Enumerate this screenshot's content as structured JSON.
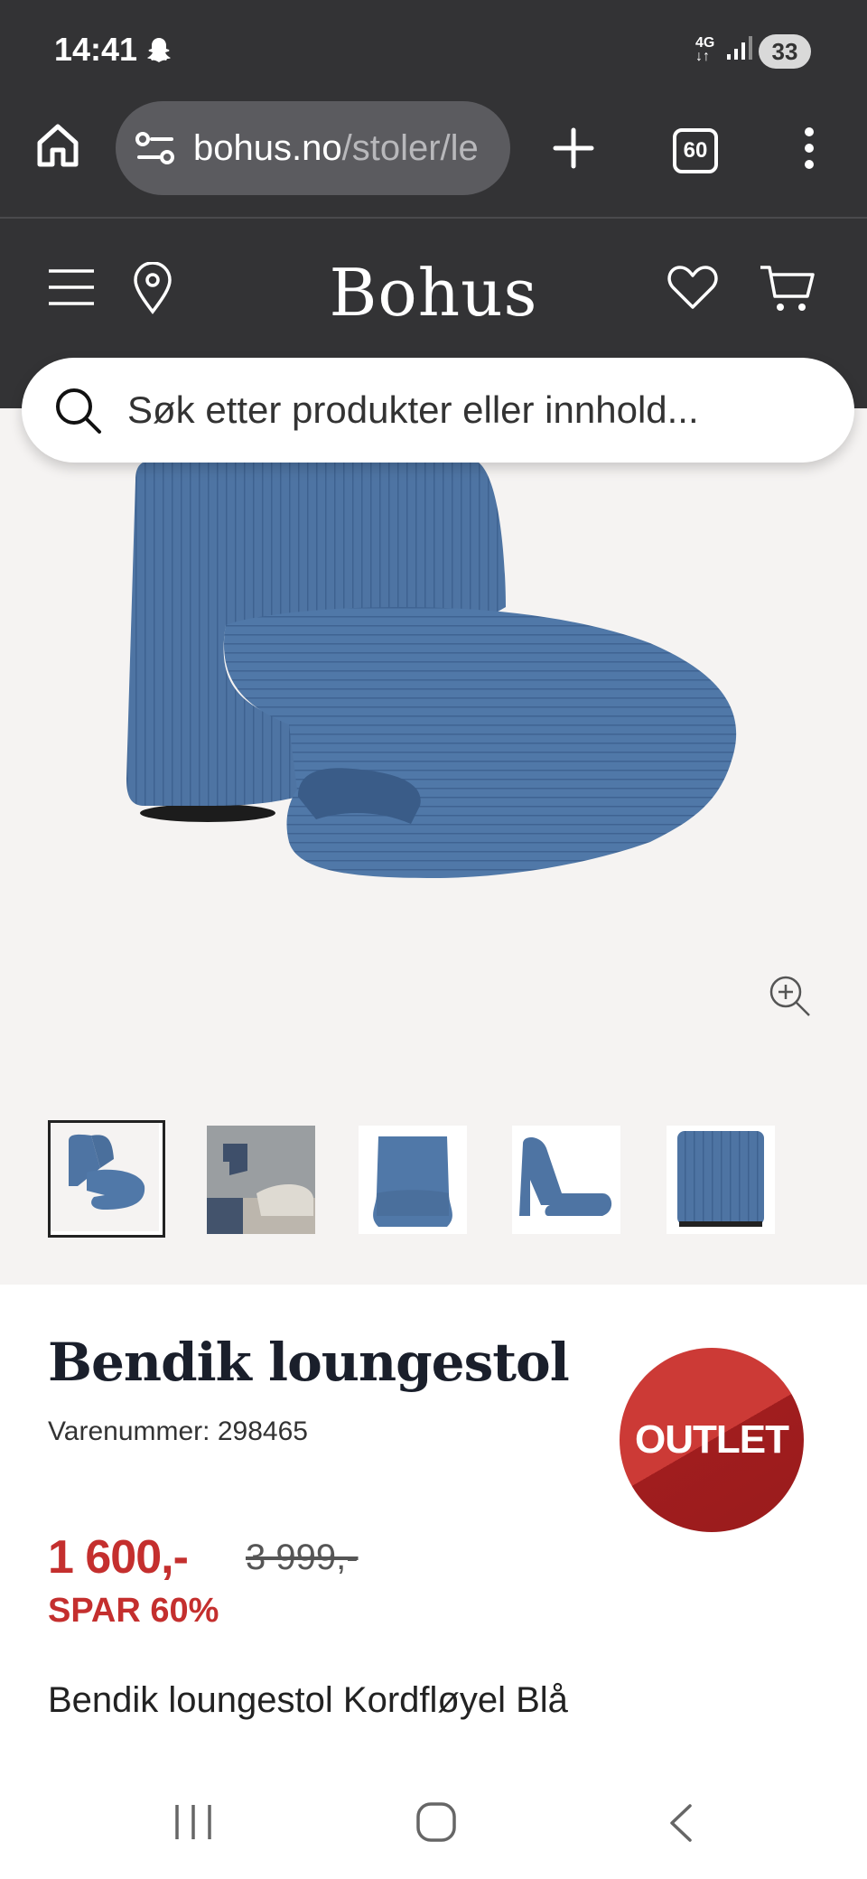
{
  "status_bar": {
    "time": "14:41",
    "network": "4G",
    "battery": "33"
  },
  "browser": {
    "url_host": "bohus.no",
    "url_path": "/stoler/le",
    "tab_count": "60"
  },
  "header": {
    "logo": "Bohus"
  },
  "search": {
    "placeholder": "Søk etter produkter eller innhold..."
  },
  "gallery": {
    "thumbnail_count": 5,
    "selected_index": 0
  },
  "product": {
    "title": "Bendik loungestol",
    "sku": "Varenummer: 298465",
    "badge": "OUTLET",
    "price": "1 600,-",
    "old_price": "3 999,-",
    "savings": "SPAR 60%",
    "description": "Bendik loungestol Kordfløyel Blå"
  },
  "colors": {
    "chrome": "#333335",
    "sale_red": "#c42f2e",
    "chair_blue": "#4e74a3"
  }
}
